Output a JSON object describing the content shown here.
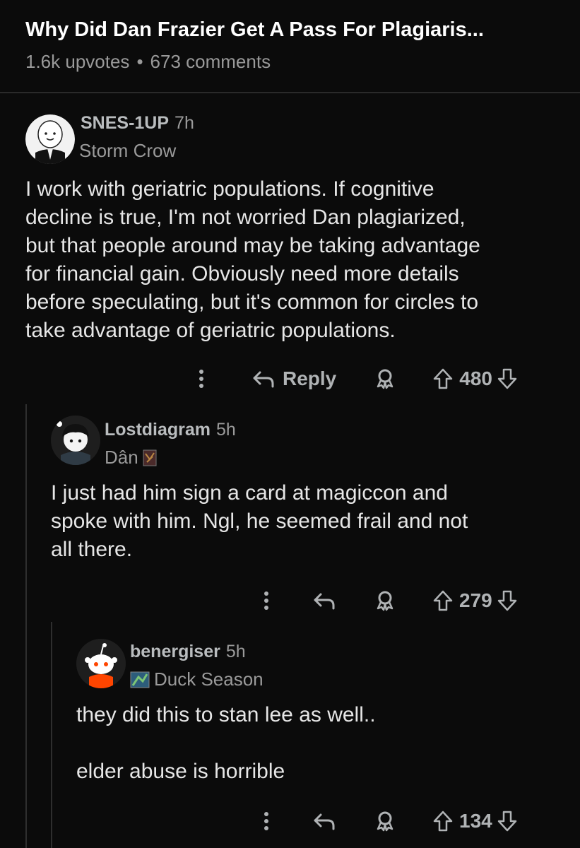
{
  "post": {
    "title": "Why Did Dan Frazier Get A Pass For Plagiaris...",
    "upvotes": "1.6k upvotes",
    "separator": "•",
    "comments": "673 comments"
  },
  "comments": [
    {
      "username": "SNES-1UP",
      "age": "7h",
      "flair": "Storm Crow",
      "body": [
        "I work with geriatric populations. If cognitive",
        "decline is true, I'm not worried Dan plagiarized,",
        "but that people around may be taking advantage",
        "for financial gain. Obviously need more details",
        "before speculating, but it's common for circles to",
        "take advantage of geriatric populations."
      ],
      "reply_label": "Reply",
      "score": "480"
    },
    {
      "username": "Lostdiagram",
      "age": "5h",
      "flair": "Dân",
      "body": [
        "I just had him sign a card at magiccon and",
        "spoke with him. Ngl, he seemed frail and not",
        "all there."
      ],
      "score": "279"
    },
    {
      "username": "benergiser",
      "age": "5h",
      "flair": "Duck Season",
      "body": [
        "they did this to stan lee as well..",
        "",
        "elder abuse is horrible"
      ],
      "score": "134"
    }
  ],
  "icons": {
    "more": "more-vertical-icon",
    "reply": "reply-arrow-icon",
    "award": "award-icon",
    "upvote": "upvote-arrow-icon",
    "downvote": "downvote-arrow-icon"
  },
  "colors": {
    "background": "#0b0b0b",
    "text": "#e6e6e6",
    "muted": "#9a9a9a"
  }
}
